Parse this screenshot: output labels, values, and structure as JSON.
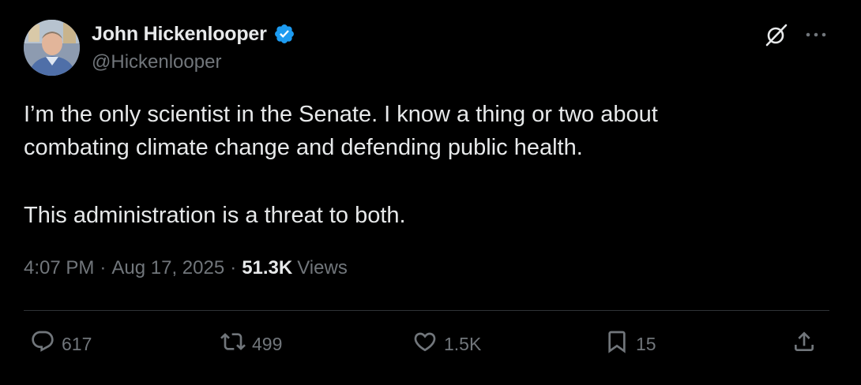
{
  "author": {
    "display_name": "John Hickenlooper",
    "handle": "@Hickenlooper",
    "verified_color": "#1d9bf0"
  },
  "tweet": {
    "lines": [
      "I’m the only scientist in the Senate. I know a thing or two about",
      "combating climate change and defending public health."
    ],
    "paragraph2": "This administration is a threat to both."
  },
  "meta": {
    "time": "4:07 PM",
    "separator": "·",
    "date": "Aug 17, 2025",
    "views_count": "51.3K",
    "views_label": "Views"
  },
  "actions": {
    "reply": {
      "icon": "reply-icon",
      "count": "617"
    },
    "repost": {
      "icon": "repost-icon",
      "count": "499"
    },
    "like": {
      "icon": "heart-icon",
      "count": "1.5K"
    },
    "bookmark": {
      "icon": "bookmark-icon",
      "count": "15"
    },
    "share": {
      "icon": "share-icon"
    }
  },
  "header_icons": {
    "grok": "grok-icon",
    "more": "more-options-icon"
  },
  "colors": {
    "background": "#000000",
    "text_primary": "#e7e9ea",
    "text_secondary": "#71767b",
    "divider": "#2f3336"
  }
}
